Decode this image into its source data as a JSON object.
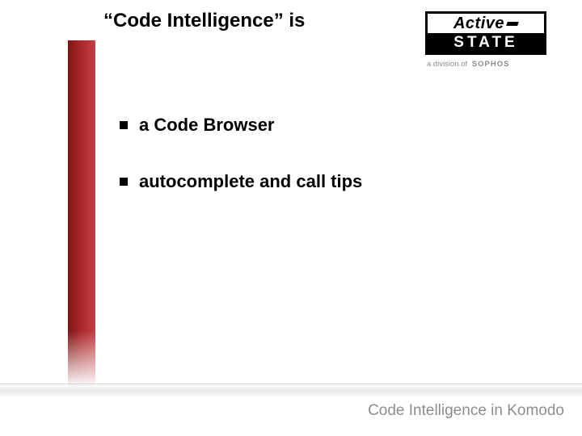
{
  "title": "“Code Intelligence” is",
  "logo": {
    "top": "Active",
    "bottom": "STATE",
    "subline_prefix": "a division of",
    "subline_brand": "SOPHOS"
  },
  "bullets": [
    {
      "text": "a Code Browser"
    },
    {
      "text": "autocomplete and call tips"
    }
  ],
  "footer": "Code Intelligence in Komodo"
}
